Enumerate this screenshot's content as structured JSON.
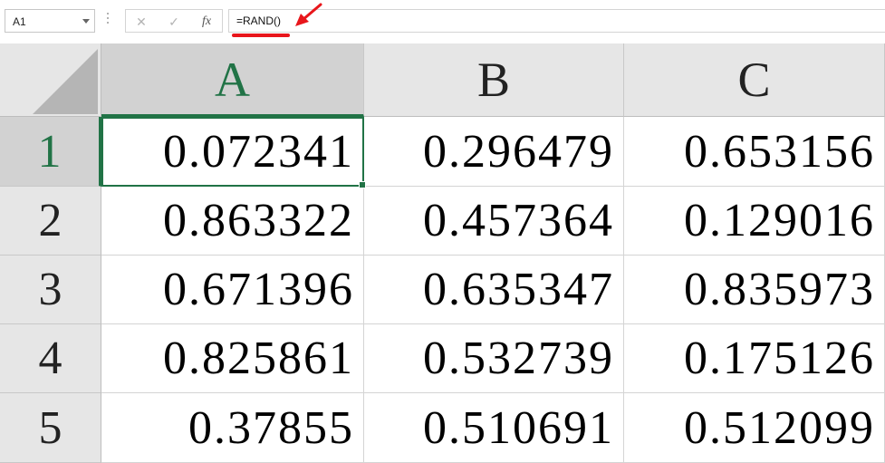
{
  "name_box": {
    "value": "A1"
  },
  "formula_bar": {
    "cancel_icon": "✕",
    "enter_icon": "✓",
    "fx_label": "fx",
    "formula": "=RAND()"
  },
  "columns": [
    "A",
    "B",
    "C"
  ],
  "rows": [
    "1",
    "2",
    "3",
    "4",
    "5"
  ],
  "cells": [
    [
      "0.072341",
      "0.296479",
      "0.653156"
    ],
    [
      "0.863322",
      "0.457364",
      "0.129016"
    ],
    [
      "0.671396",
      "0.635347",
      "0.835973"
    ],
    [
      "0.825861",
      "0.532739",
      "0.175126"
    ],
    [
      "0.37855",
      "0.510691",
      "0.512099"
    ]
  ],
  "selected_cell": "A1",
  "colors": {
    "accent_green": "#217346",
    "annotation_red": "#e8161b",
    "header_bg": "#e6e6e6"
  },
  "icons": {
    "cancel": "close-icon",
    "enter": "check-icon",
    "function": "fx-icon",
    "dropdown": "chevron-down-icon",
    "annotation": "red-arrow-icon"
  }
}
